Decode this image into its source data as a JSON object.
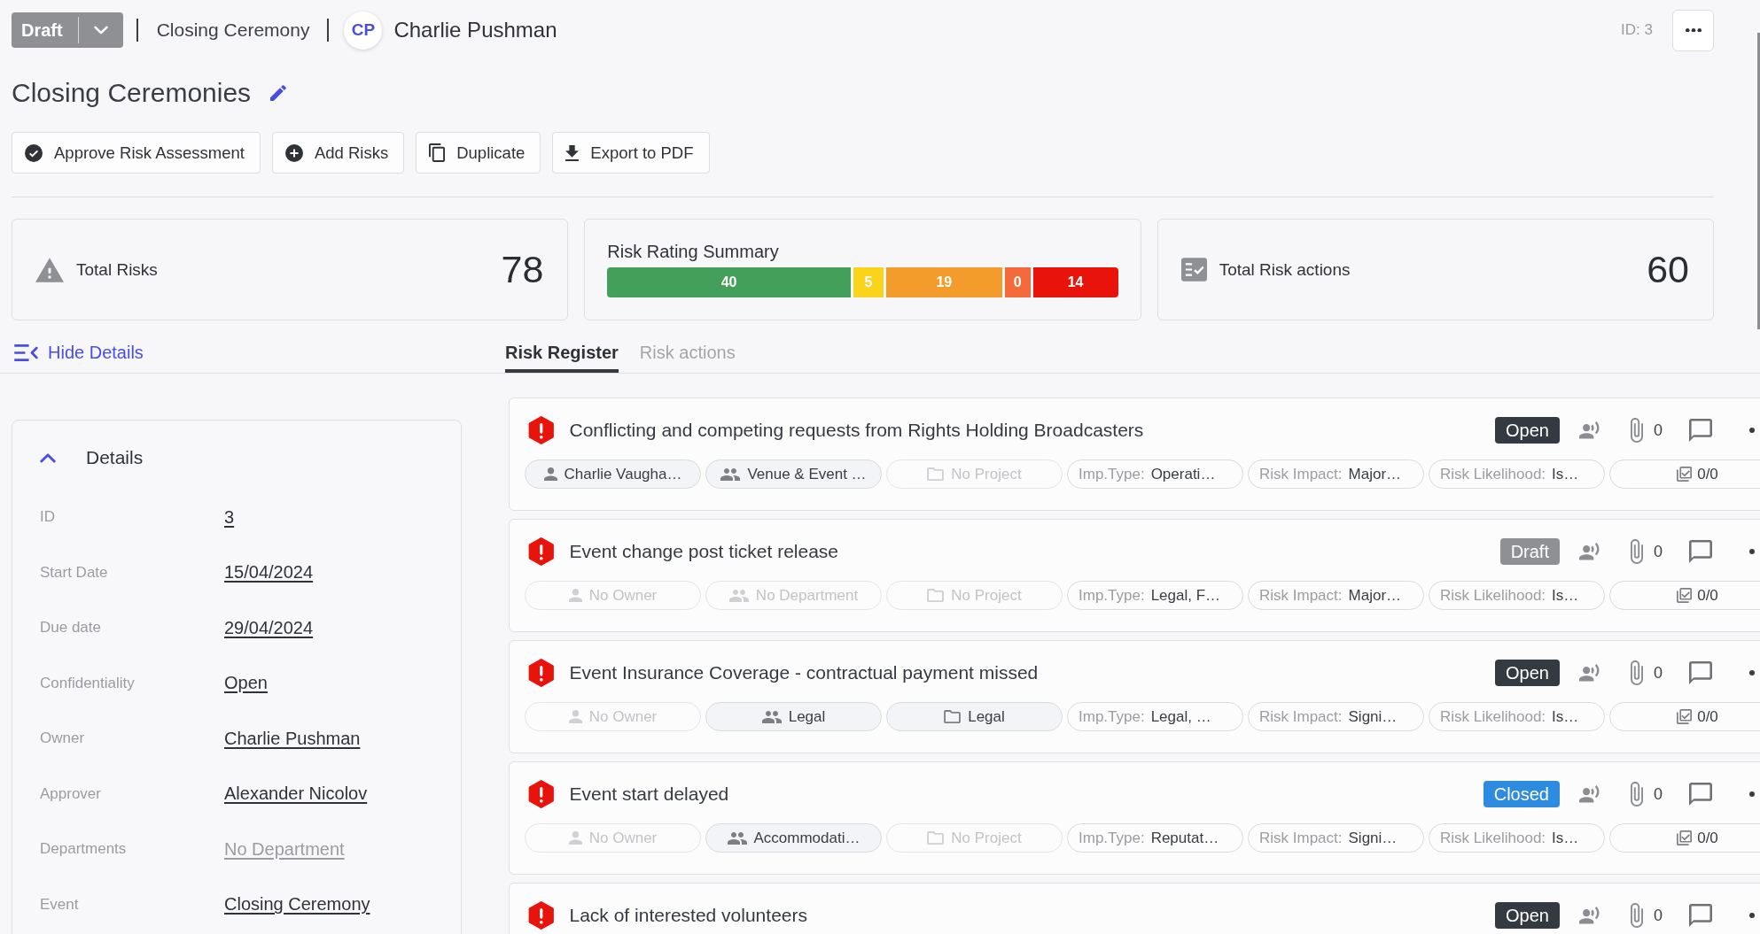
{
  "header": {
    "status": "Draft",
    "event": "Closing Ceremony",
    "user": {
      "initials": "CP",
      "name": "Charlie Pushman"
    },
    "id_label": "ID: 3"
  },
  "title": "Closing Ceremonies",
  "actions": [
    {
      "kind": "approve",
      "label": "Approve Risk Assessment"
    },
    {
      "kind": "add",
      "label": "Add Risks"
    },
    {
      "kind": "duplicate",
      "label": "Duplicate"
    },
    {
      "kind": "export",
      "label": "Export to PDF"
    }
  ],
  "stats": [
    {
      "kind": "risks",
      "label": "Total Risks",
      "value": "78"
    },
    {
      "kind": "rating",
      "label": "Risk Rating Summary",
      "segments": [
        {
          "value": "40",
          "color": "#43a05a"
        },
        {
          "value": "5",
          "color": "#f9d41b"
        },
        {
          "value": "19",
          "color": "#f49c2b"
        },
        {
          "value": "0",
          "color": "#f46a3a"
        },
        {
          "value": "14",
          "color": "#e8140c"
        }
      ]
    },
    {
      "kind": "actions",
      "label": "Total Risk actions",
      "value": "60"
    }
  ],
  "hide_details": "Hide Details",
  "tabs": [
    {
      "label": "Risk Register",
      "selected": true
    },
    {
      "label": "Risk actions",
      "selected": false
    }
  ],
  "details": {
    "title": "Details",
    "expanded": true,
    "fields": [
      {
        "label": "ID",
        "value": "3"
      },
      {
        "label": "Start Date",
        "value": "15/04/2024"
      },
      {
        "label": "Due date",
        "value": "29/04/2024"
      },
      {
        "label": "Confidentiality",
        "value": "Open"
      },
      {
        "label": "Owner",
        "value": "Charlie Pushman"
      },
      {
        "label": "Approver",
        "value": "Alexander Nicolov"
      },
      {
        "label": "Departments",
        "placeholder": "No Department"
      },
      {
        "label": "Event",
        "value": "Closing Ceremony"
      }
    ]
  },
  "risks": [
    {
      "title": "Conflicting and competing requests from Rights Holding Broadcasters",
      "status": {
        "label": "Open",
        "color": "#343a42"
      },
      "attachments": "0",
      "chips": [
        {
          "kind": "owner",
          "value": "Charlie Vaugha…"
        },
        {
          "kind": "department",
          "value": "Venue & Event …"
        },
        {
          "kind": "project",
          "placeholder": "No Project"
        },
        {
          "kind": "field",
          "label": "Imp.Type:",
          "value": "Operati…"
        },
        {
          "kind": "field",
          "label": "Risk Impact:",
          "value": "Major…"
        },
        {
          "kind": "field",
          "label": "Risk Likelihood:",
          "value": "Is…"
        },
        {
          "kind": "actions",
          "value": "0/0"
        }
      ]
    },
    {
      "title": "Event change post ticket release",
      "status": {
        "label": "Draft",
        "color": "#8f9093"
      },
      "attachments": "0",
      "chips": [
        {
          "kind": "owner",
          "placeholder": "No Owner"
        },
        {
          "kind": "department",
          "placeholder": "No Department"
        },
        {
          "kind": "project",
          "placeholder": "No Project"
        },
        {
          "kind": "field",
          "label": "Imp.Type:",
          "value": "Legal, F…"
        },
        {
          "kind": "field",
          "label": "Risk Impact:",
          "value": "Major…"
        },
        {
          "kind": "field",
          "label": "Risk Likelihood:",
          "value": "Is…"
        },
        {
          "kind": "actions",
          "value": "0/0"
        }
      ]
    },
    {
      "title": "Event Insurance Coverage - contractual payment missed",
      "status": {
        "label": "Open",
        "color": "#343a42"
      },
      "attachments": "0",
      "chips": [
        {
          "kind": "owner",
          "placeholder": "No Owner"
        },
        {
          "kind": "department",
          "value": "Legal"
        },
        {
          "kind": "project",
          "value": "Legal"
        },
        {
          "kind": "field",
          "label": "Imp.Type:",
          "value": "Legal, …"
        },
        {
          "kind": "field",
          "label": "Risk Impact:",
          "value": "Signi…"
        },
        {
          "kind": "field",
          "label": "Risk Likelihood:",
          "value": "Is…"
        },
        {
          "kind": "actions",
          "value": "0/0"
        }
      ]
    },
    {
      "title": "Event start delayed",
      "status": {
        "label": "Closed",
        "color": "#2e8ce0"
      },
      "attachments": "0",
      "chips": [
        {
          "kind": "owner",
          "placeholder": "No Owner"
        },
        {
          "kind": "department",
          "value": "Accommodati…"
        },
        {
          "kind": "project",
          "placeholder": "No Project"
        },
        {
          "kind": "field",
          "label": "Imp.Type:",
          "value": "Reputat…"
        },
        {
          "kind": "field",
          "label": "Risk Impact:",
          "value": "Signi…"
        },
        {
          "kind": "field",
          "label": "Risk Likelihood:",
          "value": "Is…"
        },
        {
          "kind": "actions",
          "value": "0/0"
        }
      ]
    },
    {
      "title": "Lack of interested volunteers",
      "status": {
        "label": "Open",
        "color": "#343a42"
      },
      "attachments": "0"
    }
  ]
}
